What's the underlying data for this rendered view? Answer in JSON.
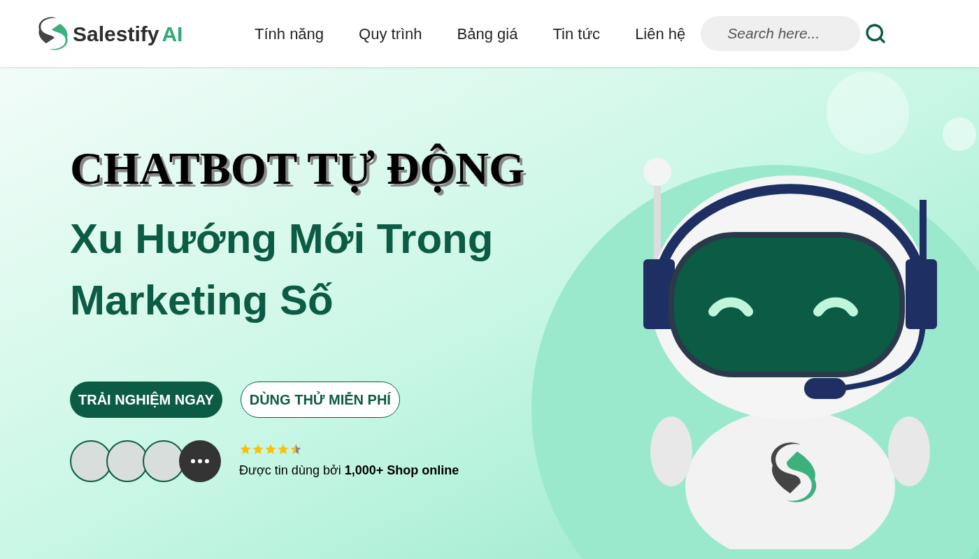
{
  "logo": {
    "name": "Salestify",
    "suffix": "AI"
  },
  "nav": [
    "Tính năng",
    "Quy trình",
    "Bảng giá",
    "Tin tức",
    "Liên hệ"
  ],
  "search": {
    "placeholder": "Search here..."
  },
  "hero": {
    "title": "CHATBOT TỰ ĐỘNG",
    "subtitle": "Xu Hướng Mới Trong Marketing Số",
    "buttons": [
      {
        "label": "TRẢI NGHIỆM NGAY",
        "kind": "primary"
      },
      {
        "label": "DÙNG THỬ MIỄN PHÍ",
        "kind": "outline"
      }
    ],
    "trust": {
      "stars": 4.5,
      "text": "Được tin dùng bởi **1,000+ Shop online**"
    }
  }
}
